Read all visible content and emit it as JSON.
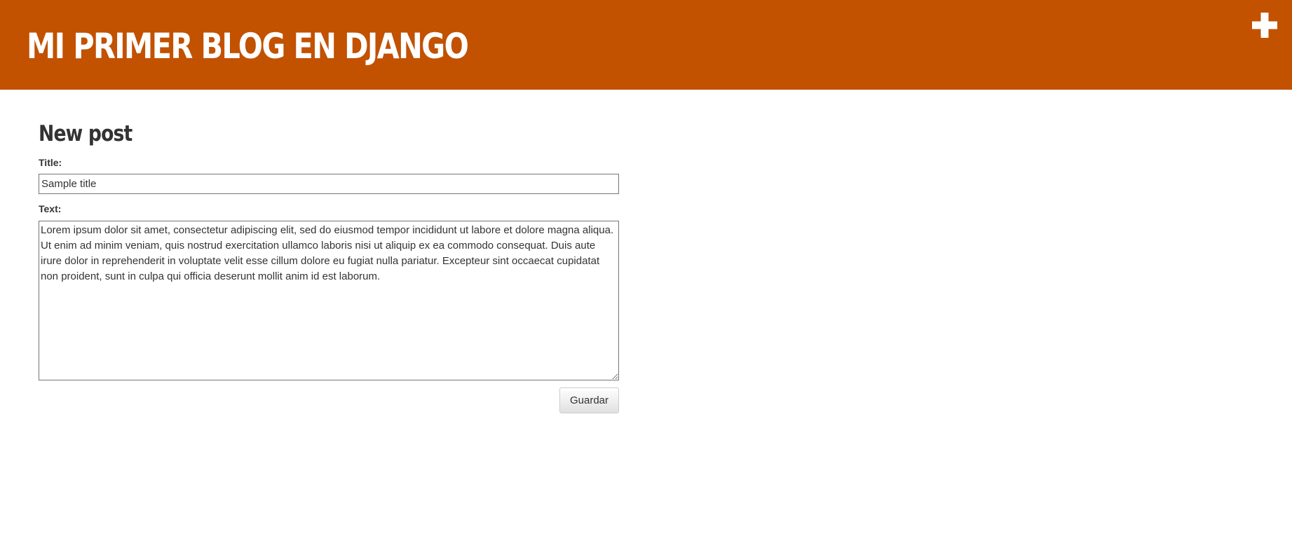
{
  "header": {
    "site_title": "MI PRIMER BLOG EN DJANGO",
    "add_icon": "plus-icon",
    "background_color": "#c25100"
  },
  "form": {
    "heading": "New post",
    "title_label": "Title:",
    "title_value": "Sample title",
    "text_label": "Text:",
    "text_value": "Lorem ipsum dolor sit amet, consectetur adipiscing elit, sed do eiusmod tempor incididunt ut labore et dolore magna aliqua. Ut enim ad minim veniam, quis nostrud exercitation ullamco laboris nisi ut aliquip ex ea commodo consequat. Duis aute irure dolor in reprehenderit in voluptate velit esse cillum dolore eu fugiat nulla pariatur. Excepteur sint occaecat cupidatat non proident, sunt in culpa qui officia deserunt mollit anim id est laborum.",
    "save_label": "Guardar"
  }
}
